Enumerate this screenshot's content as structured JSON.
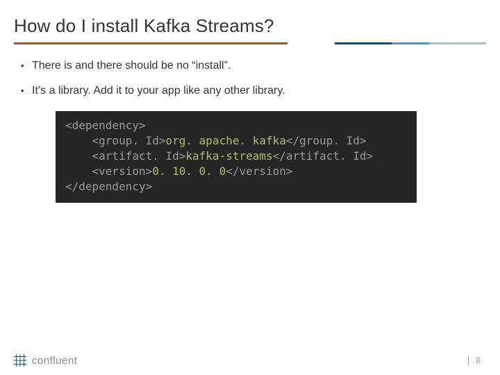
{
  "title": "How do I install Kafka Streams?",
  "bullets": [
    "There is and there should be no “install”.",
    "It’s a library.  Add it to your app like any other library."
  ],
  "code": {
    "l1_open": "<dependency>",
    "l2_open": "    <group. Id>",
    "l2_val": "org. apache. kafka",
    "l2_close": "</group. Id>",
    "l3_open": "    <artifact. Id>",
    "l3_val": "kafka-streams",
    "l3_close": "</artifact. Id>",
    "l4_open": "    <version>",
    "l4_val": "0. 10. 0. 0",
    "l4_close": "</version>",
    "l5_close": "</dependency>"
  },
  "footer": {
    "brand": "confluent",
    "page": "8"
  }
}
